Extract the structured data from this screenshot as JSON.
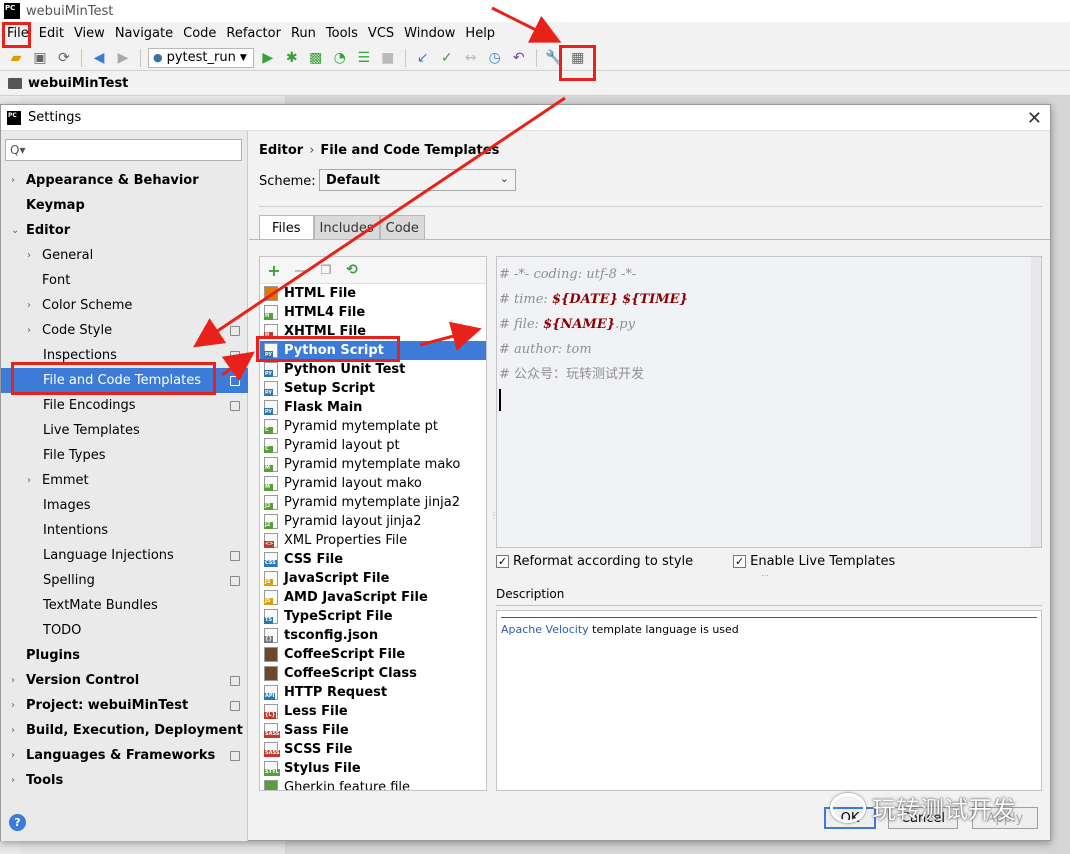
{
  "ide": {
    "window_title": "webuiMinTest",
    "logo_text": "PC",
    "menus": [
      "File",
      "Edit",
      "View",
      "Navigate",
      "Code",
      "Refactor",
      "Run",
      "Tools",
      "VCS",
      "Window",
      "Help"
    ],
    "run_config": "pytest_run",
    "breadcrumb": "webuiMinTest"
  },
  "dialog": {
    "title": "Settings",
    "search_placeholder": "Q▾",
    "tree": [
      {
        "label": "Appearance & Behavior",
        "level": 0,
        "bold": true,
        "arrow": "›",
        "proj": false
      },
      {
        "label": "Keymap",
        "level": 0,
        "bold": true,
        "arrow": "",
        "proj": false
      },
      {
        "label": "Editor",
        "level": 0,
        "bold": true,
        "arrow": "⌄",
        "proj": false
      },
      {
        "label": "General",
        "level": 1,
        "bold": false,
        "arrow": "›",
        "proj": false
      },
      {
        "label": "Font",
        "level": 1,
        "bold": false,
        "arrow": "",
        "proj": false
      },
      {
        "label": "Color Scheme",
        "level": 1,
        "bold": false,
        "arrow": "›",
        "proj": false
      },
      {
        "label": "Code Style",
        "level": 1,
        "bold": false,
        "arrow": "›",
        "proj": true
      },
      {
        "label": "Inspections",
        "level": 2,
        "bold": false,
        "arrow": "",
        "proj": true
      },
      {
        "label": "File and Code Templates",
        "level": 2,
        "bold": false,
        "arrow": "",
        "proj": true,
        "selected": true
      },
      {
        "label": "File Encodings",
        "level": 2,
        "bold": false,
        "arrow": "",
        "proj": true
      },
      {
        "label": "Live Templates",
        "level": 2,
        "bold": false,
        "arrow": "",
        "proj": false
      },
      {
        "label": "File Types",
        "level": 2,
        "bold": false,
        "arrow": "",
        "proj": false
      },
      {
        "label": "Emmet",
        "level": 1,
        "bold": false,
        "arrow": "›",
        "proj": false
      },
      {
        "label": "Images",
        "level": 2,
        "bold": false,
        "arrow": "",
        "proj": false
      },
      {
        "label": "Intentions",
        "level": 2,
        "bold": false,
        "arrow": "",
        "proj": false
      },
      {
        "label": "Language Injections",
        "level": 2,
        "bold": false,
        "arrow": "",
        "proj": true
      },
      {
        "label": "Spelling",
        "level": 2,
        "bold": false,
        "arrow": "",
        "proj": true
      },
      {
        "label": "TextMate Bundles",
        "level": 2,
        "bold": false,
        "arrow": "",
        "proj": false
      },
      {
        "label": "TODO",
        "level": 2,
        "bold": false,
        "arrow": "",
        "proj": false
      },
      {
        "label": "Plugins",
        "level": 0,
        "bold": true,
        "arrow": "",
        "proj": false
      },
      {
        "label": "Version Control",
        "level": 0,
        "bold": true,
        "arrow": "›",
        "proj": true
      },
      {
        "label": "Project: webuiMinTest",
        "level": 0,
        "bold": true,
        "arrow": "›",
        "proj": true
      },
      {
        "label": "Build, Execution, Deployment",
        "level": 0,
        "bold": true,
        "arrow": "›",
        "proj": false
      },
      {
        "label": "Languages & Frameworks",
        "level": 0,
        "bold": true,
        "arrow": "›",
        "proj": true
      },
      {
        "label": "Tools",
        "level": 0,
        "bold": true,
        "arrow": "›",
        "proj": false
      }
    ],
    "breadcrumb": [
      "Editor",
      "File and Code Templates"
    ],
    "scheme_label": "Scheme:",
    "scheme_value": "Default",
    "tabs": [
      "Files",
      "Includes",
      "Code"
    ],
    "templates": [
      {
        "label": "HTML File",
        "bold": true,
        "tag": "",
        "tagColor": "#e07b00"
      },
      {
        "label": "HTML4 File",
        "bold": true,
        "tag": "H",
        "tagColor": "#5a9e3a"
      },
      {
        "label": "XHTML File",
        "bold": true,
        "tag": "H",
        "tagColor": "#c0392b"
      },
      {
        "label": "Python Script",
        "bold": true,
        "tag": "py",
        "tagColor": "#3572a5",
        "selected": true
      },
      {
        "label": "Python Unit Test",
        "bold": true,
        "tag": "py",
        "tagColor": "#3572a5"
      },
      {
        "label": "Setup Script",
        "bold": true,
        "tag": "py",
        "tagColor": "#3572a5"
      },
      {
        "label": "Flask Main",
        "bold": true,
        "tag": "py",
        "tagColor": "#3572a5"
      },
      {
        "label": "Pyramid mytemplate pt",
        "bold": false,
        "tag": "C",
        "tagColor": "#5a9e3a"
      },
      {
        "label": "Pyramid layout pt",
        "bold": false,
        "tag": "C",
        "tagColor": "#5a9e3a"
      },
      {
        "label": "Pyramid mytemplate mako",
        "bold": false,
        "tag": "M",
        "tagColor": "#5a9e3a"
      },
      {
        "label": "Pyramid layout mako",
        "bold": false,
        "tag": "M",
        "tagColor": "#5a9e3a"
      },
      {
        "label": "Pyramid mytemplate jinja2",
        "bold": false,
        "tag": "J2",
        "tagColor": "#5a9e3a"
      },
      {
        "label": "Pyramid layout jinja2",
        "bold": false,
        "tag": "J2",
        "tagColor": "#5a9e3a"
      },
      {
        "label": "XML Properties File",
        "bold": false,
        "tag": "<>",
        "tagColor": "#c0392b"
      },
      {
        "label": "CSS File",
        "bold": true,
        "tag": "CSS",
        "tagColor": "#2a7ab0"
      },
      {
        "label": "JavaScript File",
        "bold": true,
        "tag": "JS",
        "tagColor": "#d4a017"
      },
      {
        "label": "AMD JavaScript File",
        "bold": true,
        "tag": "JS",
        "tagColor": "#d4a017"
      },
      {
        "label": "TypeScript File",
        "bold": true,
        "tag": "TS",
        "tagColor": "#2a7ab0"
      },
      {
        "label": "tsconfig.json",
        "bold": true,
        "tag": "{}",
        "tagColor": "#777"
      },
      {
        "label": "CoffeeScript File",
        "bold": true,
        "tag": "",
        "tagColor": "#6b4a2a"
      },
      {
        "label": "CoffeeScript Class",
        "bold": true,
        "tag": "",
        "tagColor": "#6b4a2a"
      },
      {
        "label": "HTTP Request",
        "bold": true,
        "tag": "API",
        "tagColor": "#2a7ab0"
      },
      {
        "label": "Less File",
        "bold": true,
        "tag": "{L}",
        "tagColor": "#c0392b"
      },
      {
        "label": "Sass File",
        "bold": true,
        "tag": "SASS",
        "tagColor": "#c0392b"
      },
      {
        "label": "SCSS File",
        "bold": true,
        "tag": "SASS",
        "tagColor": "#c0392b"
      },
      {
        "label": "Stylus File",
        "bold": true,
        "tag": "STYL",
        "tagColor": "#5a9e3a"
      },
      {
        "label": "Gherkin feature file",
        "bold": false,
        "tag": "",
        "tagColor": "#5a9e3a"
      }
    ],
    "editor_lines": [
      {
        "segments": [
          {
            "t": "# -*- coding: utf-8 -*-",
            "c": "comment"
          }
        ]
      },
      {
        "segments": [
          {
            "t": "# time: ",
            "c": "comment"
          },
          {
            "t": "${DATE}",
            "c": "var"
          },
          {
            "t": " ",
            "c": "comment"
          },
          {
            "t": "${TIME}",
            "c": "var"
          }
        ]
      },
      {
        "segments": [
          {
            "t": "# file: ",
            "c": "comment"
          },
          {
            "t": "${NAME}",
            "c": "var"
          },
          {
            "t": ".py",
            "c": "comment"
          }
        ]
      },
      {
        "segments": [
          {
            "t": "# author: tom",
            "c": "comment"
          }
        ]
      },
      {
        "segments": [
          {
            "t": "# ",
            "c": "comment"
          },
          {
            "t": "公众号：玩转测试开发",
            "c": "cjk"
          }
        ]
      }
    ],
    "reformat_label": "Reformat according to style",
    "live_templates_label": "Enable Live Templates",
    "description_label": "Description",
    "description_link": "Apache Velocity",
    "description_text": " template language is used",
    "ok_label": "OK",
    "cancel_label": "Cancel",
    "apply_label": "Apply"
  },
  "watermark": "玩转测试开发",
  "colors": {
    "selection": "#3d7bd9",
    "annotation": "#e8221b"
  }
}
